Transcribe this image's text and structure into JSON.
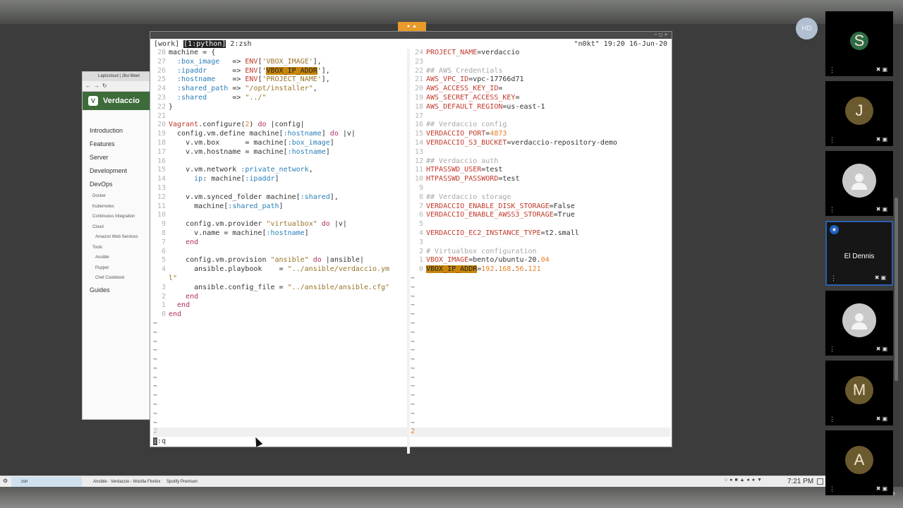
{
  "presenter_initials": "HD",
  "participants": [
    {
      "initial": "S",
      "color": "#2e6b47",
      "size": 26
    },
    {
      "initial": "J",
      "color": "#6b5a2e",
      "size": 40
    },
    {
      "initial": "",
      "color": "#c8c8c8",
      "size": 48,
      "generic": true
    },
    {
      "name": "El Dennis",
      "active": true
    },
    {
      "initial": "",
      "color": "#c8c8c8",
      "size": 48,
      "generic": true
    },
    {
      "initial": "M",
      "color": "#6b5a2e",
      "size": 40
    },
    {
      "initial": "A",
      "color": "#6b5a2e",
      "size": 40
    }
  ],
  "browser": {
    "tab": "Lapizcloud | Jitsi Meet",
    "site_name": "Verdaccio",
    "logo": "V",
    "nav": [
      {
        "label": "Introduction",
        "level": 0
      },
      {
        "label": "Features",
        "level": 0
      },
      {
        "label": "Server",
        "level": 0
      },
      {
        "label": "Development",
        "level": 0
      },
      {
        "label": "DevOps",
        "level": 0
      },
      {
        "label": "Docker",
        "level": 1
      },
      {
        "label": "Kubernetes",
        "level": 1
      },
      {
        "label": "Continuous Integration",
        "level": 1
      },
      {
        "label": "Cloud",
        "level": 1
      },
      {
        "label": "Amazon Web Services",
        "level": 2
      },
      {
        "label": "Tools",
        "level": 1
      },
      {
        "label": "Ansible",
        "level": 2
      },
      {
        "label": "Puppet",
        "level": 2
      },
      {
        "label": "Chef Cookbook",
        "level": 2
      },
      {
        "label": "Guides",
        "level": 0
      }
    ]
  },
  "terminal": {
    "session": "[work]",
    "window1": "[1:python]",
    "window2": "2:zsh",
    "host": "\"n0kt\"",
    "time": "19:20",
    "date": "16-Jun-20",
    "left_lines": [
      {
        "n": "28",
        "c": [
          [
            "tk-op",
            "machine = {"
          ]
        ]
      },
      {
        "n": "27",
        "c": [
          [
            "tk-sym",
            "  :box_image"
          ],
          [
            "tk-op",
            "   => "
          ],
          [
            "tk-var",
            "ENV"
          ],
          [
            "tk-op",
            "["
          ],
          [
            "tk-str",
            "'VBOX_IMAGE'"
          ],
          [
            "tk-op",
            "],"
          ]
        ]
      },
      {
        "n": "26",
        "c": [
          [
            "tk-sym",
            "  :ipaddr"
          ],
          [
            "tk-op",
            "      => "
          ],
          [
            "tk-var",
            "ENV"
          ],
          [
            "tk-op",
            "['"
          ],
          [
            "tk-hl",
            "VBOX_IP_ADDR"
          ],
          [
            "tk-op",
            "'],"
          ]
        ]
      },
      {
        "n": "25",
        "c": [
          [
            "tk-sym",
            "  :hostname"
          ],
          [
            "tk-op",
            "    => "
          ],
          [
            "tk-var",
            "ENV"
          ],
          [
            "tk-op",
            "["
          ],
          [
            "tk-str",
            "'PROJECT_NAME'"
          ],
          [
            "tk-op",
            "],"
          ]
        ]
      },
      {
        "n": "24",
        "c": [
          [
            "tk-sym",
            "  :shared_path"
          ],
          [
            "tk-op",
            " => "
          ],
          [
            "tk-str",
            "\"/opt/installer\""
          ],
          [
            "tk-op",
            ","
          ]
        ]
      },
      {
        "n": "23",
        "c": [
          [
            "tk-sym",
            "  :shared"
          ],
          [
            "tk-op",
            "      => "
          ],
          [
            "tk-str",
            "\"../\""
          ]
        ]
      },
      {
        "n": "22",
        "c": [
          [
            "tk-op",
            "}"
          ]
        ]
      },
      {
        "n": "21",
        "c": []
      },
      {
        "n": "20",
        "c": [
          [
            "tk-var",
            "Vagrant"
          ],
          [
            "tk-op",
            ".configure("
          ],
          [
            "tk-num",
            "2"
          ],
          [
            "tk-op",
            ") "
          ],
          [
            "tk-kw",
            "do"
          ],
          [
            "tk-op",
            " |config|"
          ]
        ]
      },
      {
        "n": "19",
        "c": [
          [
            "tk-op",
            "  config.vm.define machine["
          ],
          [
            "tk-sym",
            ":hostname"
          ],
          [
            "tk-op",
            "] "
          ],
          [
            "tk-kw",
            "do"
          ],
          [
            "tk-op",
            " |v|"
          ]
        ]
      },
      {
        "n": "18",
        "c": [
          [
            "tk-op",
            "    v.vm.box      = machine["
          ],
          [
            "tk-sym",
            ":box_image"
          ],
          [
            "tk-op",
            "]"
          ]
        ]
      },
      {
        "n": "17",
        "c": [
          [
            "tk-op",
            "    v.vm.hostname = machine["
          ],
          [
            "tk-sym",
            ":hostname"
          ],
          [
            "tk-op",
            "]"
          ]
        ]
      },
      {
        "n": "16",
        "c": []
      },
      {
        "n": "15",
        "c": [
          [
            "tk-op",
            "    v.vm.network "
          ],
          [
            "tk-sym",
            ":private_network"
          ],
          [
            "tk-op",
            ","
          ]
        ]
      },
      {
        "n": "14",
        "c": [
          [
            "tk-sym",
            "      ip"
          ],
          [
            "tk-op",
            ": machine["
          ],
          [
            "tk-sym",
            ":ipaddr"
          ],
          [
            "tk-op",
            "]"
          ]
        ]
      },
      {
        "n": "13",
        "c": []
      },
      {
        "n": "12",
        "c": [
          [
            "tk-op",
            "    v.vm.synced_folder machine["
          ],
          [
            "tk-sym",
            ":shared"
          ],
          [
            "tk-op",
            "],"
          ]
        ]
      },
      {
        "n": "11",
        "c": [
          [
            "tk-op",
            "      machine["
          ],
          [
            "tk-sym",
            ":shared_path"
          ],
          [
            "tk-op",
            "]"
          ]
        ]
      },
      {
        "n": "10",
        "c": []
      },
      {
        "n": "9",
        "c": [
          [
            "tk-op",
            "    config.vm.provider "
          ],
          [
            "tk-str",
            "\"virtualbox\""
          ],
          [
            "tk-op",
            " "
          ],
          [
            "tk-kw",
            "do"
          ],
          [
            "tk-op",
            " |v|"
          ]
        ]
      },
      {
        "n": "8",
        "c": [
          [
            "tk-op",
            "      v.name = machine["
          ],
          [
            "tk-sym",
            ":hostname"
          ],
          [
            "tk-op",
            "]"
          ]
        ]
      },
      {
        "n": "7",
        "c": [
          [
            "tk-kw",
            "    end"
          ]
        ]
      },
      {
        "n": "6",
        "c": []
      },
      {
        "n": "5",
        "c": [
          [
            "tk-op",
            "    config.vm.provision "
          ],
          [
            "tk-str",
            "\"ansible\""
          ],
          [
            "tk-op",
            " "
          ],
          [
            "tk-kw",
            "do"
          ],
          [
            "tk-op",
            " |ansible|"
          ]
        ]
      },
      {
        "n": "4",
        "c": [
          [
            "tk-op",
            "      ansible.playbook    = "
          ],
          [
            "tk-str",
            "\"../ansible/verdaccio.ym"
          ]
        ]
      },
      {
        "n": "",
        "c": [
          [
            "tk-str",
            "l\""
          ]
        ]
      },
      {
        "n": "3",
        "c": [
          [
            "tk-op",
            "      ansible.config_file = "
          ],
          [
            "tk-str",
            "\"../ansible/ansible.cfg\""
          ]
        ]
      },
      {
        "n": "2",
        "c": [
          [
            "tk-kw",
            "    end"
          ]
        ]
      },
      {
        "n": "1",
        "c": [
          [
            "tk-kw",
            "  end"
          ]
        ]
      },
      {
        "n": "0",
        "c": [
          [
            "tk-kw",
            "end"
          ]
        ]
      }
    ],
    "right_lines": [
      {
        "n": "24",
        "c": [
          [
            "tk-var",
            "PROJECT_NAME"
          ],
          [
            "tk-op",
            "=verdaccio"
          ]
        ]
      },
      {
        "n": "23",
        "c": []
      },
      {
        "n": "22",
        "c": [
          [
            "tk-cm",
            "## AWS Credentials"
          ]
        ]
      },
      {
        "n": "21",
        "c": [
          [
            "tk-var",
            "AWS_VPC_ID"
          ],
          [
            "tk-op",
            "=vpc-17766d71"
          ]
        ]
      },
      {
        "n": "20",
        "c": [
          [
            "tk-var",
            "AWS_ACCESS_KEY_ID"
          ],
          [
            "tk-op",
            "="
          ]
        ]
      },
      {
        "n": "19",
        "c": [
          [
            "tk-var",
            "AWS_SECRET_ACCESS_KEY"
          ],
          [
            "tk-op",
            "="
          ]
        ]
      },
      {
        "n": "18",
        "c": [
          [
            "tk-var",
            "AWS_DEFAULT_REGION"
          ],
          [
            "tk-op",
            "=us-east-1"
          ]
        ]
      },
      {
        "n": "17",
        "c": []
      },
      {
        "n": "16",
        "c": [
          [
            "tk-cm",
            "## Verdaccio config"
          ]
        ]
      },
      {
        "n": "15",
        "c": [
          [
            "tk-var",
            "VERDACCIO_PORT"
          ],
          [
            "tk-op",
            "="
          ],
          [
            "tk-num",
            "4873"
          ]
        ]
      },
      {
        "n": "14",
        "c": [
          [
            "tk-var",
            "VERDACCIO_S3_BUCKET"
          ],
          [
            "tk-op",
            "=verdaccio-repository-demo"
          ]
        ]
      },
      {
        "n": "13",
        "c": []
      },
      {
        "n": "12",
        "c": [
          [
            "tk-cm",
            "## Verdaccio auth"
          ]
        ]
      },
      {
        "n": "11",
        "c": [
          [
            "tk-var",
            "HTPASSWD_USER"
          ],
          [
            "tk-op",
            "=test"
          ]
        ]
      },
      {
        "n": "10",
        "c": [
          [
            "tk-var",
            "HTPASSWD_PASSWORD"
          ],
          [
            "tk-op",
            "=test"
          ]
        ]
      },
      {
        "n": "9",
        "c": []
      },
      {
        "n": "8",
        "c": [
          [
            "tk-cm",
            "## Verdaccio storage"
          ]
        ]
      },
      {
        "n": "7",
        "c": [
          [
            "tk-var",
            "VERDACCIO_ENABLE_DISK_STORAGE"
          ],
          [
            "tk-op",
            "=False"
          ]
        ]
      },
      {
        "n": "6",
        "c": [
          [
            "tk-var",
            "VERDACCIO_ENABLE_AWSS3_STORAGE"
          ],
          [
            "tk-op",
            "=True"
          ]
        ]
      },
      {
        "n": "5",
        "c": []
      },
      {
        "n": "4",
        "c": [
          [
            "tk-var",
            "VERDACCIO_EC2_INSTANCE_TYPE"
          ],
          [
            "tk-op",
            "=t2.small"
          ]
        ]
      },
      {
        "n": "3",
        "c": []
      },
      {
        "n": "2",
        "c": [
          [
            "tk-cm",
            "# Virtualbox configuration"
          ]
        ]
      },
      {
        "n": "1",
        "c": [
          [
            "tk-var",
            "VBOX_IMAGE"
          ],
          [
            "tk-op",
            "=bento/ubuntu-20."
          ],
          [
            "tk-num",
            "04"
          ]
        ]
      },
      {
        "n": "0",
        "c": [
          [
            "tk-hl",
            "VBOX_IP_ADDR"
          ],
          [
            "tk-op",
            "="
          ],
          [
            "tk-num",
            "192"
          ],
          [
            "tk-op",
            "."
          ],
          [
            "tk-num",
            "168"
          ],
          [
            "tk-op",
            "."
          ],
          [
            "tk-num",
            "56"
          ],
          [
            "tk-op",
            "."
          ],
          [
            "tk-num",
            "121"
          ]
        ]
      }
    ],
    "left_status": "2",
    "right_status": "2",
    "command": ":q"
  },
  "taskbar": {
    "tasks": [
      {
        "label": "zsh",
        "active": true
      },
      {
        "label": "Ansible · Verdaccio - Mozilla Firefox",
        "active": false
      },
      {
        "label": "Spotify Premium",
        "active": false
      }
    ],
    "clock": "7:21 PM"
  }
}
